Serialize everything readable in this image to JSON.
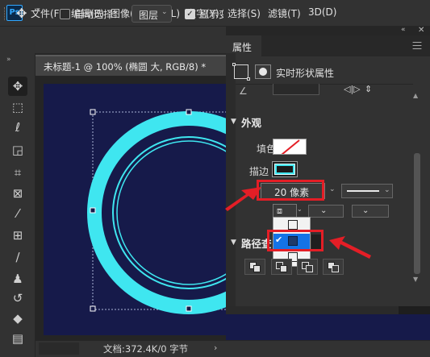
{
  "app": {
    "logo": "Ps"
  },
  "menu": [
    "文件(F)",
    "编辑(E)",
    "图像(I)",
    "图层(L)",
    "文字(Y)",
    "选择(S)",
    "滤镜(T)",
    "3D(D)"
  ],
  "options": {
    "auto_select_label": "自动选择：",
    "layer_select_value": "图层",
    "show_label": "显示变",
    "show_checked": "✓"
  },
  "document": {
    "tab_title": "未标题-1 @ 100% (椭圆 大, RGB/8) *",
    "status_text": "文档:372.4K/0 字节"
  },
  "toolbar": {
    "tools": [
      "move-tool",
      "marquee-tool",
      "lasso-tool",
      "object-select-tool",
      "crop-tool",
      "frame-tool",
      "eyedropper-tool",
      "healing-tool",
      "brush-tool",
      "stamp-tool",
      "history-brush-tool",
      "eraser-tool",
      "gradient-tool"
    ]
  },
  "panel": {
    "tab_label": "属性",
    "live_shape_label": "实时形状属性",
    "appearance_label": "外观",
    "fill_label": "填色",
    "stroke_label": "描边",
    "stroke_width_value": "20 像素",
    "path_ops_label": "路径查",
    "stroke_color": "#3fe6f0",
    "selected_align_option": "inside"
  },
  "canvas": {
    "background_color": "#161a4a",
    "ring_color": "#3fe6f0"
  },
  "annotations": {
    "highlight_color": "#e41e26"
  }
}
